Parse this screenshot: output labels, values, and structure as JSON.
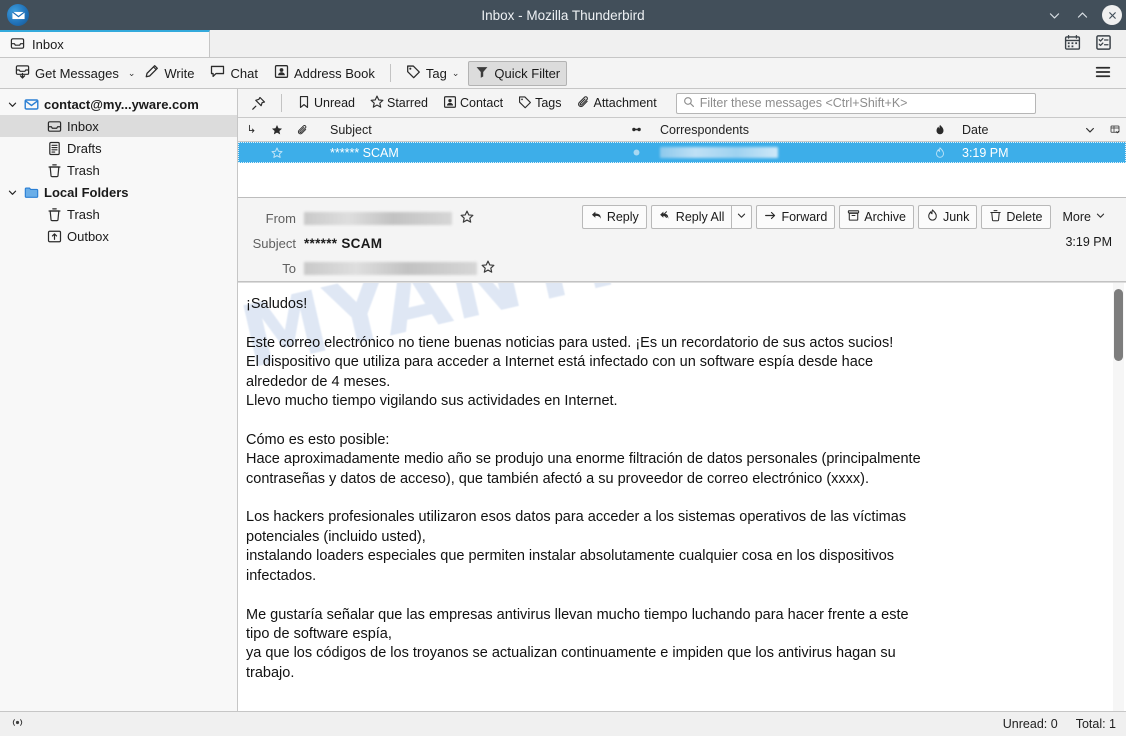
{
  "window": {
    "title": "Inbox - Mozilla Thunderbird",
    "logo_icon": "thunderbird-logo-icon",
    "controls": [
      {
        "name": "minimize-button",
        "glyph": "⌄"
      },
      {
        "name": "maximize-button",
        "glyph": "⌃"
      },
      {
        "name": "close-button",
        "glyph": "✕"
      }
    ]
  },
  "tabbar": {
    "tab_label": "Inbox",
    "tab_icon": "inbox-icon",
    "calendar_icon": "calendar-icon",
    "tasks_icon": "tasks-icon"
  },
  "toolbar": {
    "get_messages": "Get Messages",
    "write": "Write",
    "chat": "Chat",
    "address_book": "Address Book",
    "tag": "Tag",
    "quick_filter": "Quick Filter",
    "menu_icon": "hamburger-menu-icon"
  },
  "folder_pane": {
    "items": [
      {
        "label": "contact@my...yware.com",
        "icon": "mail-account-icon",
        "level": 0,
        "expanded": true,
        "bold": true,
        "selected": false
      },
      {
        "label": "Inbox",
        "icon": "inbox-icon",
        "level": 1,
        "expanded": null,
        "bold": false,
        "selected": true
      },
      {
        "label": "Drafts",
        "icon": "drafts-icon",
        "level": 1,
        "expanded": null,
        "bold": false,
        "selected": false
      },
      {
        "label": "Trash",
        "icon": "trash-icon",
        "level": 1,
        "expanded": null,
        "bold": false,
        "selected": false
      },
      {
        "label": "Local Folders",
        "icon": "folder-icon",
        "level": 0,
        "expanded": true,
        "bold": true,
        "selected": false
      },
      {
        "label": "Trash",
        "icon": "trash-icon",
        "level": 1,
        "expanded": null,
        "bold": false,
        "selected": false
      },
      {
        "label": "Outbox",
        "icon": "outbox-icon",
        "level": 1,
        "expanded": null,
        "bold": false,
        "selected": false
      }
    ]
  },
  "quick_filter": {
    "pin_icon": "pin-filter-icon",
    "buttons": [
      {
        "label": "Unread",
        "icon": "unread-icon"
      },
      {
        "label": "Starred",
        "icon": "star-icon"
      },
      {
        "label": "Contact",
        "icon": "contact-icon"
      },
      {
        "label": "Tags",
        "icon": "tag-icon"
      },
      {
        "label": "Attachment",
        "icon": "paperclip-icon"
      }
    ],
    "search_placeholder": "Filter these messages <Ctrl+Shift+K>",
    "search_value": "",
    "search_icon": "search-icon"
  },
  "thread_columns": {
    "thread_icon": "thread-icon",
    "star_icon": "star-icon",
    "attachment_icon": "paperclip-icon",
    "subject": "Subject",
    "unread_icon": "unread-dot-icon",
    "correspondents": "Correspondents",
    "junk_icon": "junk-flame-icon",
    "date": "Date",
    "sort_icon": "sort-descending-icon",
    "column_picker_icon": "column-picker-icon"
  },
  "messages": [
    {
      "subject": "****** SCAM",
      "correspondent": "[redacted]",
      "correspondent_redacted": true,
      "date": "3:19 PM",
      "selected": true,
      "starred": false,
      "read": true
    }
  ],
  "message_header": {
    "from_label": "From",
    "from_value": "[redacted]",
    "subject_label": "Subject",
    "subject_value": "****** SCAM",
    "to_label": "To",
    "to_value": "[redacted]",
    "date": "3:19 PM",
    "star_icon": "star-outline-icon",
    "actions": [
      {
        "label": "Reply",
        "icon": "reply-icon"
      },
      {
        "label": "Reply All",
        "icon": "reply-all-icon"
      },
      {
        "label": "",
        "icon": "chevron-down-icon"
      },
      {
        "label": "Forward",
        "icon": "forward-arrow-icon"
      },
      {
        "label": "Archive",
        "icon": "archive-box-icon"
      },
      {
        "label": "Junk",
        "icon": "junk-flame-icon"
      },
      {
        "label": "Delete",
        "icon": "trash-icon"
      },
      {
        "label": "More",
        "icon": "chevron-down-icon"
      }
    ]
  },
  "message_body": {
    "watermark": "MYANTISPYWARE.COM",
    "text": "¡Saludos!\n\nEste correo electrónico no tiene buenas noticias para usted. ¡Es un recordatorio de sus actos sucios!\nEl dispositivo que utiliza para acceder a Internet está infectado con un software espía desde hace\nalrededor de 4 meses.\nLlevo mucho tiempo vigilando sus actividades en Internet.\n\nCómo es esto posible:\nHace aproximadamente medio año se produjo una enorme filtración de datos personales (principalmente\ncontraseñas y datos de acceso), que también afectó a su proveedor de correo electrónico (xxxx).\n\nLos hackers profesionales utilizaron esos datos para acceder a los sistemas operativos de las víctimas\npotenciales (incluido usted),\ninstalando loaders especiales que permiten instalar absolutamente cualquier cosa en los dispositivos\ninfectados.\n\nMe gustaría señalar que las empresas antivirus llevan mucho tiempo luchando para hacer frente a este\ntipo de software espía,\nya que los códigos de los troyanos se actualizan continuamente e impiden que los antivirus hagan su\ntrabajo."
  },
  "statusbar": {
    "connection_icon": "connection-icon",
    "unread": "Unread: 0",
    "total": "Total: 1"
  },
  "colors": {
    "titlebar": "#424f5a",
    "selection": "#3daee9",
    "tab_accent": "#34aadc",
    "folder_blue": "#2a7fd4",
    "watermark": "#b9cbe8"
  }
}
